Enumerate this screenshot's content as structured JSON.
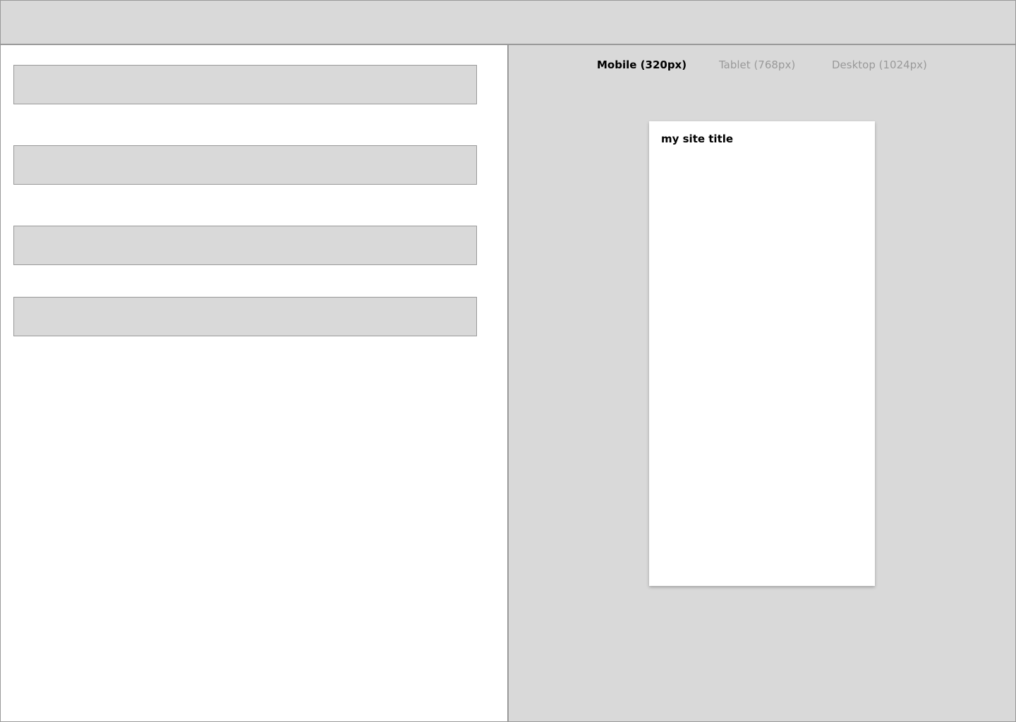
{
  "preview": {
    "tabs": [
      {
        "label": "Mobile (320px)",
        "active": true
      },
      {
        "label": "Tablet (768px)",
        "active": false
      },
      {
        "label": "Desktop (1024px)",
        "active": false
      }
    ],
    "site_title": "my site title"
  },
  "colors": {
    "panel_gray": "#d9d9d9",
    "border_gray": "#999999",
    "inactive_text": "#999999",
    "active_text": "#000000"
  }
}
